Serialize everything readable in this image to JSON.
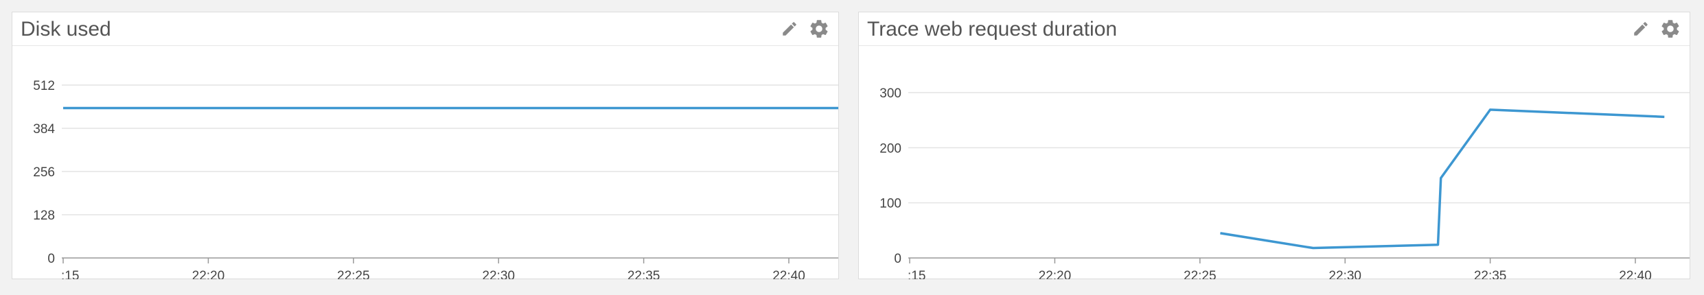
{
  "panels": [
    {
      "title": "Disk used",
      "edit_icon": "pencil-icon",
      "settings_icon": "gear-icon"
    },
    {
      "title": "Trace web request duration",
      "edit_icon": "pencil-icon",
      "settings_icon": "gear-icon"
    }
  ],
  "colors": {
    "line": "#3d97d1",
    "grid": "#e4e4e4",
    "axis": "#999999"
  },
  "chart_data": [
    {
      "type": "line",
      "title": "Disk used",
      "x_ticks": [
        ":15",
        "22:20",
        "22:25",
        "22:30",
        "22:35",
        "22:40"
      ],
      "y_ticks": [
        "0",
        "128",
        "256",
        "384",
        "512"
      ],
      "ylim": [
        0,
        512
      ],
      "xlim_minutes": [
        15,
        43.3
      ],
      "series": [
        {
          "x": [
            15,
            43.3
          ],
          "y": [
            444,
            444
          ]
        }
      ]
    },
    {
      "type": "line",
      "title": "Trace web request duration",
      "x_ticks": [
        ":15",
        "22:20",
        "22:25",
        "22:30",
        "22:35",
        "22:40"
      ],
      "y_ticks": [
        "0",
        "100",
        "200",
        "300"
      ],
      "ylim": [
        0,
        300
      ],
      "xlim_minutes": [
        15,
        43.0
      ],
      "series": [
        {
          "x": [
            25.7,
            28.9,
            33.2,
            33.3,
            35.0,
            41.0
          ],
          "y": [
            45,
            18,
            24,
            145,
            269,
            256
          ]
        }
      ]
    }
  ]
}
